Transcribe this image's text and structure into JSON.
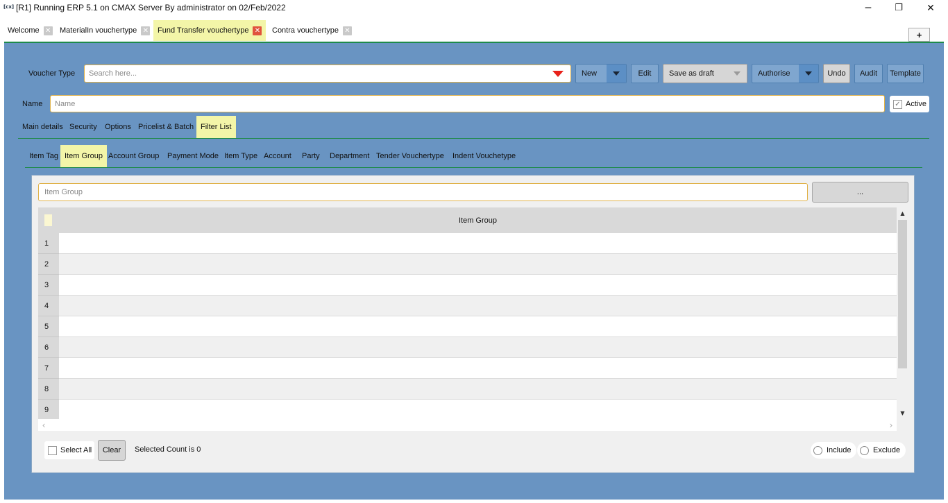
{
  "window": {
    "icon_text": "[cx]",
    "title": "[R1] Running ERP 5.1 on CMAX Server By administrator on 02/Feb/2022",
    "minimize": "─",
    "restore": "❐",
    "close": "✕"
  },
  "doc_tabs": [
    {
      "label": "Welcome",
      "close": "✕"
    },
    {
      "label": "MaterialIn vouchertype",
      "close": "✕"
    },
    {
      "label": "Fund Transfer vouchertype",
      "close": "✕",
      "active": true
    },
    {
      "label": "Contra vouchertype",
      "close": "✕"
    }
  ],
  "add_tab_label": "+",
  "toolbar": {
    "voucher_type_label": "Voucher Type",
    "search_placeholder": "Search here...",
    "new_label": "New",
    "edit_label": "Edit",
    "save_draft_label": "Save as draft",
    "authorise_label": "Authorise",
    "undo_label": "Undo",
    "audit_label": "Audit",
    "template_label": "Template"
  },
  "name_row": {
    "label": "Name",
    "placeholder": "Name",
    "active_label": "Active",
    "active_checked": true,
    "check_glyph": "✓"
  },
  "section_tabs": [
    {
      "label": "Main details"
    },
    {
      "label": "Security"
    },
    {
      "label": "Options"
    },
    {
      "label": "Pricelist & Batch"
    },
    {
      "label": "Filter List",
      "active": true
    }
  ],
  "filter_tabs": [
    {
      "label": "Item Tag"
    },
    {
      "label": "Item Group",
      "active": true
    },
    {
      "label": "Account Group"
    },
    {
      "label": "Payment Mode"
    },
    {
      "label": "Item Type"
    },
    {
      "label": "Account"
    },
    {
      "label": "Party"
    },
    {
      "label": "Department"
    },
    {
      "label": "Tender Vouchertype"
    },
    {
      "label": "Indent Vouchetype"
    }
  ],
  "filter_panel": {
    "input_placeholder": "Item Group",
    "browse_label": "...",
    "grid_header": "Item Group",
    "rows": [
      "1",
      "2",
      "3",
      "4",
      "5",
      "6",
      "7",
      "8",
      "9"
    ],
    "scroll_up": "▲",
    "scroll_down": "▼",
    "scroll_left": "‹",
    "scroll_right": "›",
    "select_all_label": "Select All",
    "clear_label": "Clear",
    "selected_count_text": "Selected Count is 0",
    "include_label": "Include",
    "exclude_label": "Exclude"
  },
  "colors": {
    "panel_blue": "#6994c2",
    "active_tab": "#f3f5a8",
    "accent_green": "#1e8a4a",
    "close_red": "#e0533d",
    "dropdown_red": "#e8211a"
  }
}
